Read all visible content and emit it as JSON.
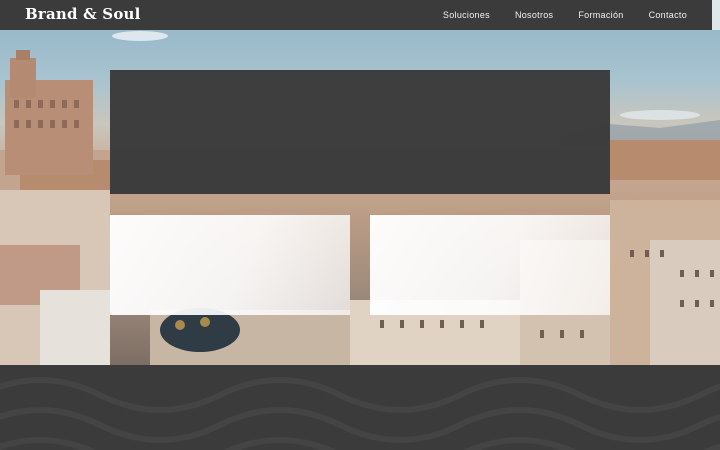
{
  "brand": {
    "name": "Brand & Soul"
  },
  "nav": {
    "items": [
      {
        "label": "Soluciones"
      },
      {
        "label": "Nosotros"
      },
      {
        "label": "Formación"
      },
      {
        "label": "Contacto"
      }
    ]
  },
  "colors": {
    "nav_bg": "#3b3b3b",
    "panel_bg": "#3a3a3a",
    "card_bg": "#ffffff",
    "text_light": "#ffffff"
  }
}
